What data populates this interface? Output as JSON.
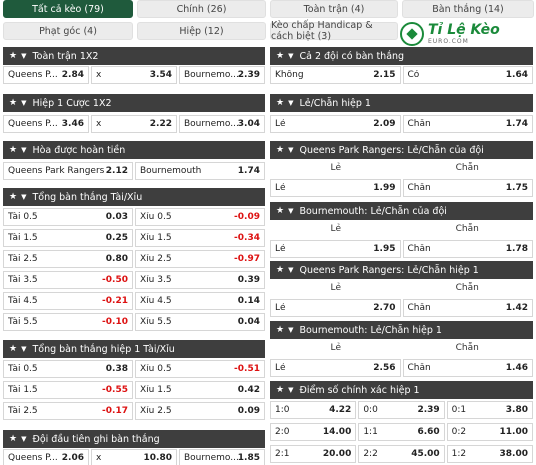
{
  "tabs": [
    {
      "label": "Tất cả kèo (79)",
      "active": true
    },
    {
      "label": "Chính (26)"
    },
    {
      "label": "Toàn trận (4)"
    },
    {
      "label": "Bàn thắng (14)"
    },
    {
      "label": "Phạt góc (4)"
    },
    {
      "label": "Hiệp (12)"
    },
    {
      "label": "Kèo chấp Handicap & cách biệt (3)"
    }
  ],
  "logo": {
    "title": "Tỉ Lệ Kèo",
    "subtitle": "EURO.COM"
  },
  "left": {
    "s1": {
      "title": "Toàn trận 1X2",
      "rows": [
        [
          {
            "l": "Queens P...",
            "o": "2.84"
          },
          {
            "l": "x",
            "o": "3.54"
          },
          {
            "l": "Bournemo...",
            "o": "2.39"
          }
        ]
      ]
    },
    "s2": {
      "title": "Hiệp 1 Cược 1X2",
      "rows": [
        [
          {
            "l": "Queens P...",
            "o": "3.46"
          },
          {
            "l": "x",
            "o": "2.22"
          },
          {
            "l": "Bournemo...",
            "o": "3.04"
          }
        ]
      ]
    },
    "s3": {
      "title": "Hòa được hoàn tiền",
      "rows": [
        [
          {
            "l": "Queens Park Rangers",
            "o": "2.12"
          },
          {
            "l": "Bournemouth",
            "o": "1.74"
          }
        ]
      ]
    },
    "s4": {
      "title": "Tổng bàn thắng Tài/Xỉu",
      "rows": [
        [
          {
            "l": "Tài 0.5",
            "o": "0.03"
          },
          {
            "l": "Xỉu 0.5",
            "o": "-0.09",
            "n": true
          }
        ],
        [
          {
            "l": "Tài 1.5",
            "o": "0.25"
          },
          {
            "l": "Xỉu 1.5",
            "o": "-0.34",
            "n": true
          }
        ],
        [
          {
            "l": "Tài 2.5",
            "o": "0.80"
          },
          {
            "l": "Xỉu 2.5",
            "o": "-0.97",
            "n": true
          }
        ],
        [
          {
            "l": "Tài 3.5",
            "o": "-0.50",
            "n": true
          },
          {
            "l": "Xỉu 3.5",
            "o": "0.39"
          }
        ],
        [
          {
            "l": "Tài 4.5",
            "o": "-0.21",
            "n": true
          },
          {
            "l": "Xỉu 4.5",
            "o": "0.14"
          }
        ],
        [
          {
            "l": "Tài 5.5",
            "o": "-0.10",
            "n": true
          },
          {
            "l": "Xỉu 5.5",
            "o": "0.04"
          }
        ]
      ]
    },
    "s5": {
      "title": "Tổng bàn thắng hiệp 1 Tài/Xỉu",
      "rows": [
        [
          {
            "l": "Tài 0.5",
            "o": "0.38"
          },
          {
            "l": "Xỉu 0.5",
            "o": "-0.51",
            "n": true
          }
        ],
        [
          {
            "l": "Tài 1.5",
            "o": "-0.55",
            "n": true
          },
          {
            "l": "Xỉu 1.5",
            "o": "0.42"
          }
        ],
        [
          {
            "l": "Tài 2.5",
            "o": "-0.17",
            "n": true
          },
          {
            "l": "Xỉu 2.5",
            "o": "0.09"
          }
        ]
      ]
    },
    "s6": {
      "title": "Đội đầu tiên ghi bàn thắng",
      "rows": [
        [
          {
            "l": "Queens P...",
            "o": "2.06"
          },
          {
            "l": "x",
            "o": "10.80"
          },
          {
            "l": "Bournemo...",
            "o": "1.85"
          }
        ]
      ]
    }
  },
  "right": {
    "r1": {
      "title": "Cả 2 đội có bàn thắng",
      "rows": [
        [
          {
            "l": "Không",
            "o": "2.15"
          },
          {
            "l": "Có",
            "o": "1.64"
          }
        ]
      ]
    },
    "r2": {
      "title": "Lẻ/Chẵn hiệp 1",
      "rows": [
        [
          {
            "l": "Lẻ",
            "o": "2.09"
          },
          {
            "l": "Chẵn",
            "o": "1.74"
          }
        ]
      ]
    },
    "r3": {
      "title": "Queens Park Rangers: Lẻ/Chẵn của đội",
      "sub": [
        "Lẻ",
        "Chẵn"
      ],
      "rows": [
        [
          {
            "l": "Lẻ",
            "o": "1.99"
          },
          {
            "l": "Chẵn",
            "o": "1.75"
          }
        ]
      ]
    },
    "r4": {
      "title": "Bournemouth: Lẻ/Chẵn của đội",
      "sub": [
        "Lẻ",
        "Chẵn"
      ],
      "rows": [
        [
          {
            "l": "Lẻ",
            "o": "1.95"
          },
          {
            "l": "Chẵn",
            "o": "1.78"
          }
        ]
      ]
    },
    "r5": {
      "title": "Queens Park Rangers: Lẻ/Chẵn hiệp 1",
      "sub": [
        "Lẻ",
        "Chẵn"
      ],
      "rows": [
        [
          {
            "l": "Lẻ",
            "o": "2.70"
          },
          {
            "l": "Chẵn",
            "o": "1.42"
          }
        ]
      ]
    },
    "r6": {
      "title": "Bournemouth: Lẻ/Chẵn hiệp 1",
      "sub": [
        "Lẻ",
        "Chẵn"
      ],
      "rows": [
        [
          {
            "l": "Lẻ",
            "o": "2.56"
          },
          {
            "l": "Chẵn",
            "o": "1.46"
          }
        ]
      ]
    },
    "r7": {
      "title": "Điểm số chính xác hiệp 1",
      "rows": [
        [
          {
            "l": "1:0",
            "o": "4.22"
          },
          {
            "l": "0:0",
            "o": "2.39"
          },
          {
            "l": "0:1",
            "o": "3.80"
          }
        ],
        [
          {
            "l": "2:0",
            "o": "14.00"
          },
          {
            "l": "1:1",
            "o": "6.60"
          },
          {
            "l": "0:2",
            "o": "11.00"
          }
        ],
        [
          {
            "l": "2:1",
            "o": "20.00"
          },
          {
            "l": "2:2",
            "o": "45.00"
          },
          {
            "l": "1:2",
            "o": "38.00"
          }
        ]
      ]
    }
  },
  "colors": {
    "active_tab": "#1f5a3c",
    "header": "#3e3e3e",
    "negative": "#dd1111"
  }
}
